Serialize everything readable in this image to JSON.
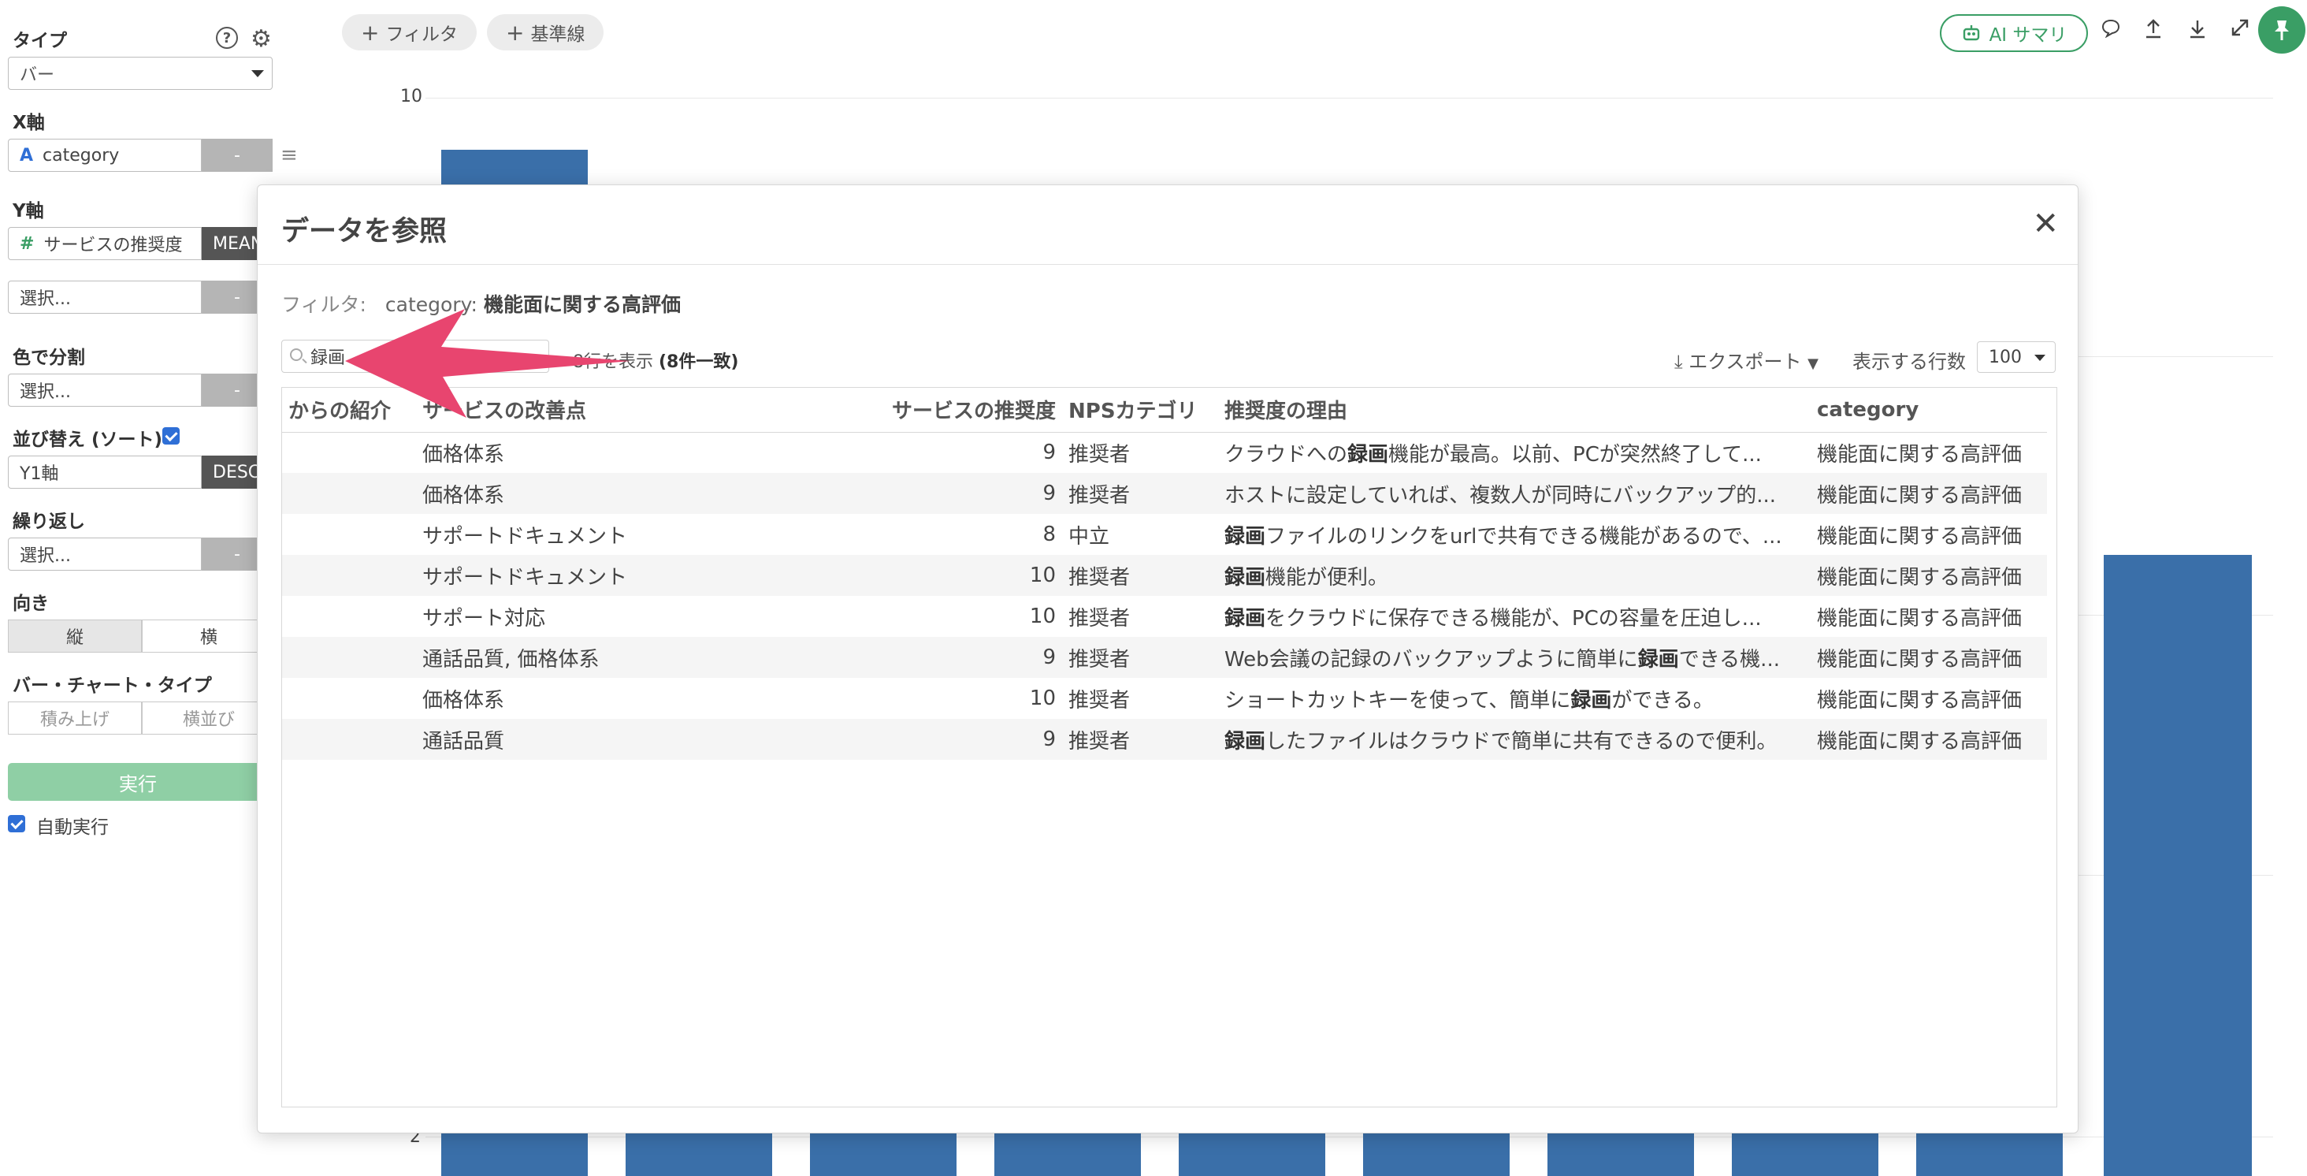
{
  "sidebar": {
    "type_label": "タイプ",
    "type_value": "バー",
    "x_axis_label": "X軸",
    "x_axis_icon": "A",
    "x_axis_value": "category",
    "x_axis_btn": "-",
    "y_axis_label": "Y軸",
    "y_axis_icon": "#",
    "y_axis_value": "サービスの推奨度",
    "y_axis_agg": "MEAN",
    "y_axis2_value": "選択...",
    "y_axis2_btn": "-",
    "color_label": "色で分割",
    "color_value": "選択...",
    "color_btn": "-",
    "sort_label": "並び替え (ソート)",
    "sort_value": "Y1軸",
    "sort_dir": "DESC",
    "repeat_label": "繰り返し",
    "repeat_value": "選択...",
    "repeat_btn": "-",
    "orientation_label": "向き",
    "orientation_vertical": "縦",
    "orientation_horizontal": "横",
    "bar_type_label": "バー・チャート・タイプ",
    "bar_type_stacked": "積み上げ",
    "bar_type_side": "横並び",
    "run_button": "実行",
    "auto_run_label": "自動実行",
    "help_glyph": "?"
  },
  "toolbar": {
    "filter_button": "フィルタ",
    "baseline_button": "基準線",
    "ai_summary_button": "AI サマリ"
  },
  "chart": {
    "ytick_top": "10",
    "ytick_bottom": "2"
  },
  "chart_data": {
    "type": "bar",
    "bar_color": "#3a6fa9",
    "ylim": [
      0,
      10
    ],
    "yticks": [
      10,
      2
    ],
    "values": [
      9.8,
      null,
      null,
      null,
      null,
      null,
      null,
      null,
      null,
      5.5
    ]
  },
  "modal": {
    "title": "データを参照",
    "filter_prefix": "フィルタ:",
    "filter_key": "category:",
    "filter_value": "機能面に関する高評価",
    "search_value": "録画",
    "rowcount_text": "8行を表示",
    "rowcount_match": "(8件一致)",
    "export_label": "エクスポート",
    "rows_label": "表示する行数",
    "rows_value": "100",
    "columns": [
      "からの紹介",
      "サービスの改善点",
      "サービスの推奨度",
      "NPSカテゴリ",
      "推奨度の理由",
      "category"
    ],
    "rows": [
      {
        "referral": "",
        "improvement": "価格体系",
        "score": "9",
        "nps": "推奨者",
        "reason_pre": "クラウドへの",
        "reason_hl": "録画",
        "reason_post": "機能が最高。以前、PCが突然終了して...",
        "category": "機能面に関する高評価"
      },
      {
        "referral": "",
        "improvement": "価格体系",
        "score": "9",
        "nps": "推奨者",
        "reason_pre": "ホストに設定していれば、複数人が同時にバックアップ的...",
        "reason_hl": "",
        "reason_post": "",
        "category": "機能面に関する高評価"
      },
      {
        "referral": "",
        "improvement": "サポートドキュメント",
        "score": "8",
        "nps": "中立",
        "reason_pre": "",
        "reason_hl": "録画",
        "reason_post": "ファイルのリンクをurlで共有できる機能があるので、...",
        "category": "機能面に関する高評価"
      },
      {
        "referral": "",
        "improvement": "サポートドキュメント",
        "score": "10",
        "nps": "推奨者",
        "reason_pre": "",
        "reason_hl": "録画",
        "reason_post": "機能が便利。",
        "category": "機能面に関する高評価"
      },
      {
        "referral": "",
        "improvement": "サポート対応",
        "score": "10",
        "nps": "推奨者",
        "reason_pre": "",
        "reason_hl": "録画",
        "reason_post": "をクラウドに保存できる機能が、PCの容量を圧迫し...",
        "category": "機能面に関する高評価"
      },
      {
        "referral": "",
        "improvement": "通話品質, 価格体系",
        "score": "9",
        "nps": "推奨者",
        "reason_pre": "Web会議の記録のバックアップように簡単に",
        "reason_hl": "録画",
        "reason_post": "できる機...",
        "category": "機能面に関する高評価"
      },
      {
        "referral": "",
        "improvement": "価格体系",
        "score": "10",
        "nps": "推奨者",
        "reason_pre": "ショートカットキーを使って、簡単に",
        "reason_hl": "録画",
        "reason_post": "ができる。",
        "category": "機能面に関する高評価"
      },
      {
        "referral": "",
        "improvement": "通話品質",
        "score": "9",
        "nps": "推奨者",
        "reason_pre": "",
        "reason_hl": "録画",
        "reason_post": "したファイルはクラウドで簡単に共有できるので便利。",
        "category": "機能面に関する高評価"
      }
    ]
  },
  "colors": {
    "accent_green": "#3a9e65",
    "run_green": "#8fcfa5",
    "bar_blue": "#3a6fa9",
    "arrow_pink": "#e8456f",
    "checkbox_blue": "#2f6fd6"
  },
  "icons": [
    "help-icon",
    "gear-icon",
    "menu-icon",
    "plus-icon",
    "robot-icon",
    "comment-icon",
    "upload-icon",
    "download-icon",
    "expand-icon",
    "pin-icon",
    "close-icon",
    "search-icon",
    "export-download-icon"
  ]
}
